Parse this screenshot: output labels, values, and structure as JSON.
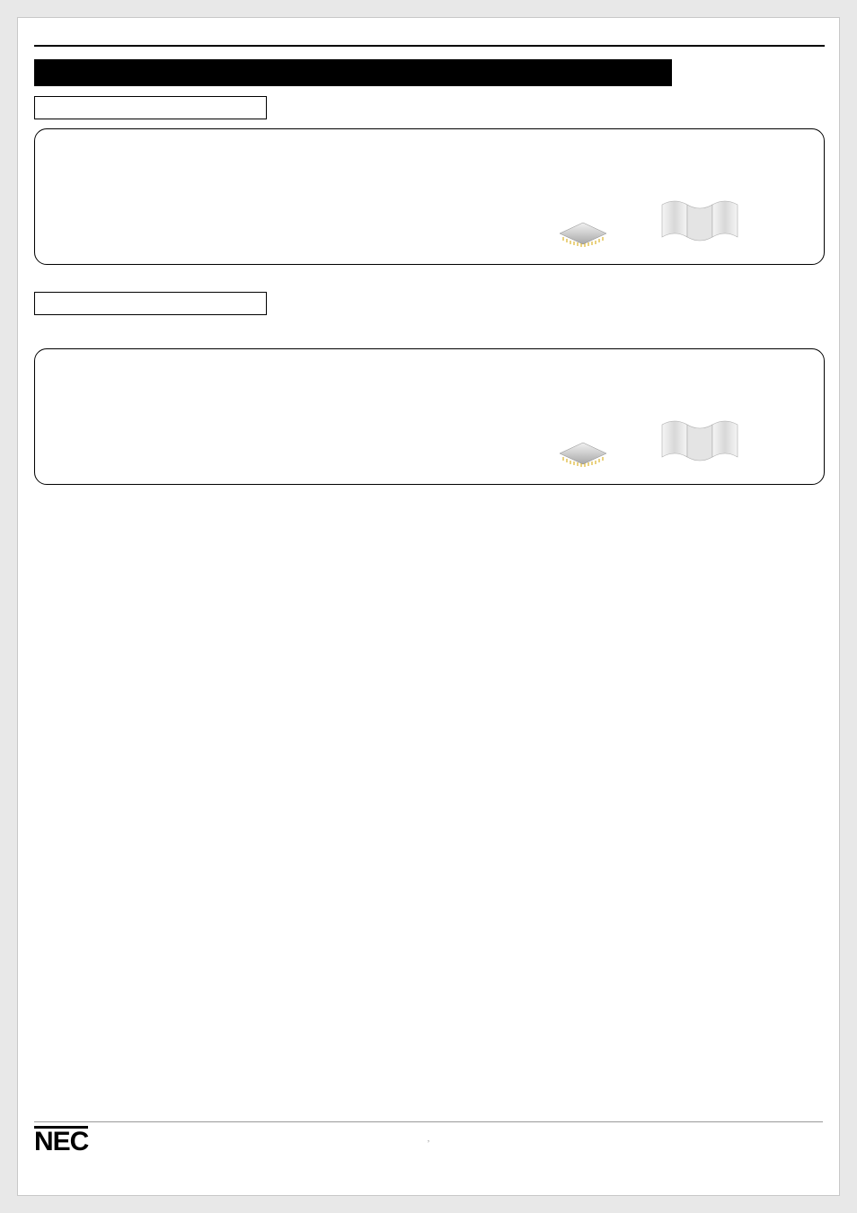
{
  "header": {
    "black_bar_label": "",
    "title_box_1": "",
    "title_box_2": ""
  },
  "panel1": {
    "chip_icon": "chip-icon",
    "doc_icon": "folded-document-icon"
  },
  "panel2": {
    "chip_icon": "chip-icon",
    "doc_icon": "folded-document-icon"
  },
  "footer": {
    "logo_text": "NEC",
    "page_mark": ","
  }
}
